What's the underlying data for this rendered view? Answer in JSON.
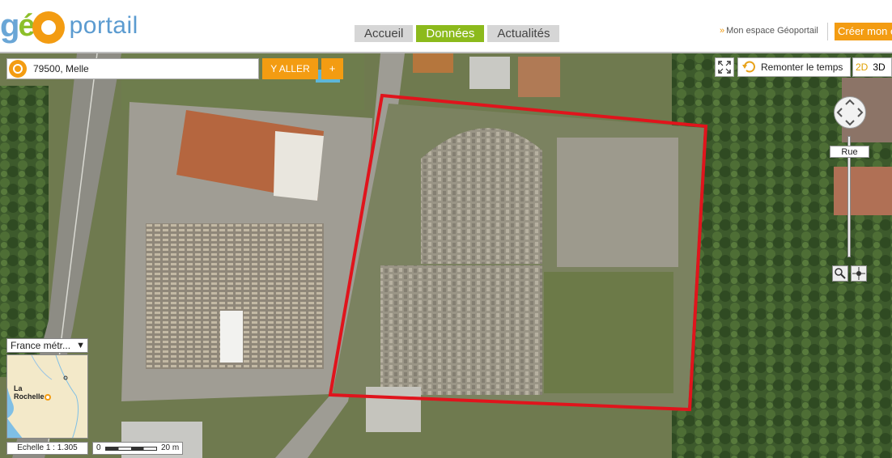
{
  "header": {
    "logo": {
      "g": "g",
      "e": "é",
      "portail": "portail"
    },
    "tabs": [
      {
        "label": "Accueil",
        "active": false
      },
      {
        "label": "Données",
        "active": true
      },
      {
        "label": "Actualités",
        "active": false
      }
    ],
    "space_link": "Mon espace Géoportail",
    "create_button": "Créer mon e"
  },
  "search": {
    "value": "79500, Melle",
    "go_label": "Y ALLER",
    "plus_label": "+"
  },
  "tools": {
    "time_label": "Remonter le temps",
    "view_2d": "2D",
    "view_3d": "3D",
    "zoom_level_label": "Rue"
  },
  "overview": {
    "select_value": "France métr...",
    "city_label_1": "La",
    "city_label_2": "Rochelle"
  },
  "scale": {
    "ratio_label": "Echelle 1 :  1.305",
    "bar_zero": "0",
    "bar_label": "20 m"
  },
  "colors": {
    "accent_orange": "#f39c12",
    "active_tab": "#8cba1c",
    "annotation_red": "#e0141c"
  }
}
